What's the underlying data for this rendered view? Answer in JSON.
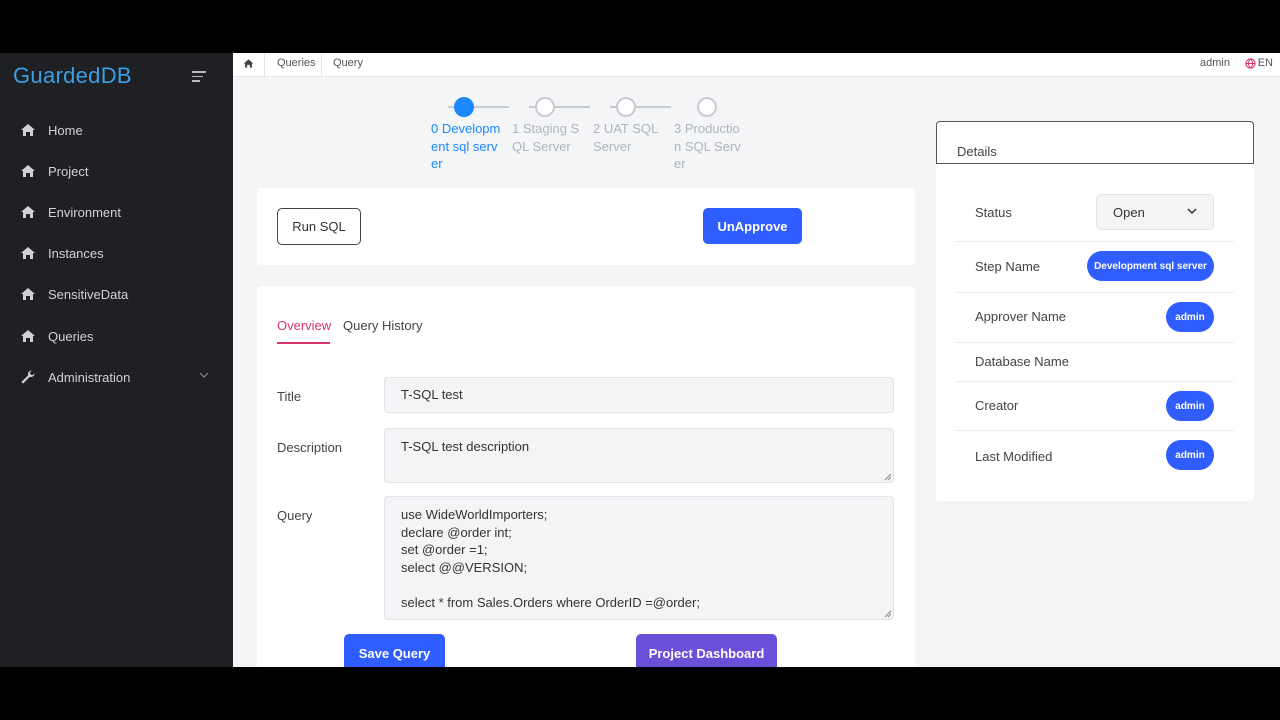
{
  "app": {
    "name": "GuardedDB"
  },
  "sidebar": {
    "items": [
      {
        "label": "Home",
        "icon": "home-icon"
      },
      {
        "label": "Project",
        "icon": "home-icon"
      },
      {
        "label": "Environment",
        "icon": "home-icon"
      },
      {
        "label": "Instances",
        "icon": "home-icon"
      },
      {
        "label": "SensitiveData",
        "icon": "home-icon"
      },
      {
        "label": "Queries",
        "icon": "home-icon"
      },
      {
        "label": "Administration",
        "icon": "wrench-icon",
        "expandable": true
      }
    ]
  },
  "topbar": {
    "breadcrumb": [
      "Queries",
      "Query"
    ],
    "user": "admin",
    "language": "EN"
  },
  "steps": [
    {
      "label": "0 Development sql server",
      "active": true
    },
    {
      "label": "1 Staging SQL Server",
      "active": false
    },
    {
      "label": "2 UAT SQL Server",
      "active": false
    },
    {
      "label": "3 Production SQL Server",
      "active": false
    }
  ],
  "actions": {
    "run_sql": "Run SQL",
    "unapprove": "UnApprove"
  },
  "tabs": {
    "overview": "Overview",
    "history": "Query History"
  },
  "form": {
    "title_label": "Title",
    "title_value": "T-SQL test",
    "description_label": "Description",
    "description_value": "T-SQL test description",
    "query_label": "Query",
    "query_lines": [
      "use WideWorldImporters;",
      "declare @order int;",
      "set @order =1;",
      "select @@VERSION;",
      "",
      "select * from Sales.Orders where OrderID =@order;"
    ],
    "save_button": "Save Query",
    "dashboard_button": "Project Dashboard"
  },
  "details": {
    "heading": "Details",
    "status_label": "Status",
    "status_value": "Open",
    "step_name_label": "Step Name",
    "step_name_value": "Development sql server",
    "approver_label": "Approver Name",
    "approver_value": "admin",
    "database_label": "Database Name",
    "creator_label": "Creator",
    "creator_value": "admin",
    "modified_label": "Last Modified",
    "modified_value": "admin"
  },
  "colors": {
    "accent_blue": "#2f5dff",
    "step_active": "#1e88ff",
    "tab_active": "#d6336c",
    "purple_button": "#6a4fd8",
    "logo": "#3aa0e6",
    "sidebar_bg": "#1f2023"
  }
}
